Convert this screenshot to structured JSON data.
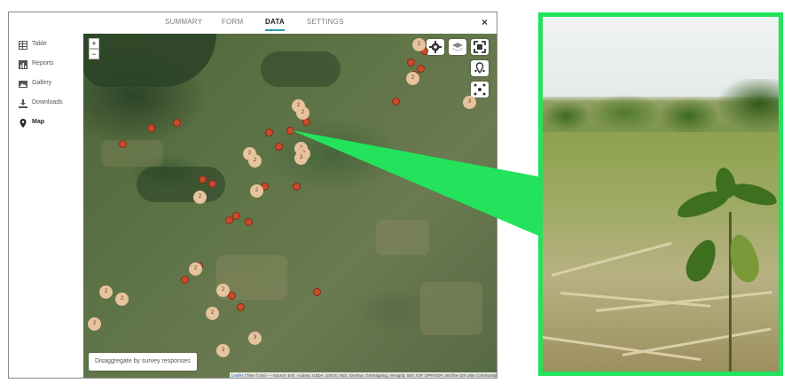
{
  "tabs": [
    "SUMMARY",
    "FORM",
    "DATA",
    "SETTINGS"
  ],
  "active_tab": "DATA",
  "close_label": "×",
  "sidebar": {
    "items": [
      {
        "label": "Table",
        "icon": "table-icon"
      },
      {
        "label": "Reports",
        "icon": "reports-icon"
      },
      {
        "label": "Gallery",
        "icon": "gallery-icon"
      },
      {
        "label": "Downloads",
        "icon": "downloads-icon"
      },
      {
        "label": "Map",
        "icon": "map-pin-icon",
        "active": true
      }
    ]
  },
  "map": {
    "zoom_in": "+",
    "zoom_out": "−",
    "disaggregate_label": "Disaggregate by survey responses",
    "attribution_leaflet": "Leaflet",
    "attribution_text": "| Tiles © Esri — Source: Esri, i-cubed, USDA, USGS, AEX, GeoEye, Getmapping, Aerogrid, IGN, IGP, UPR-EGP, and the GIS User Community",
    "clusters": [
      "2",
      "2",
      "3",
      "2",
      "2",
      "2",
      "3",
      "2",
      "2",
      "2",
      "2",
      "2",
      "2",
      "2",
      "2",
      "2",
      "2",
      "3",
      "3",
      "3"
    ]
  },
  "colors": {
    "accent": "#2e9ab0",
    "marker": "#c94a2c",
    "cluster": "#e6c5a0",
    "highlight": "#22e35b"
  }
}
